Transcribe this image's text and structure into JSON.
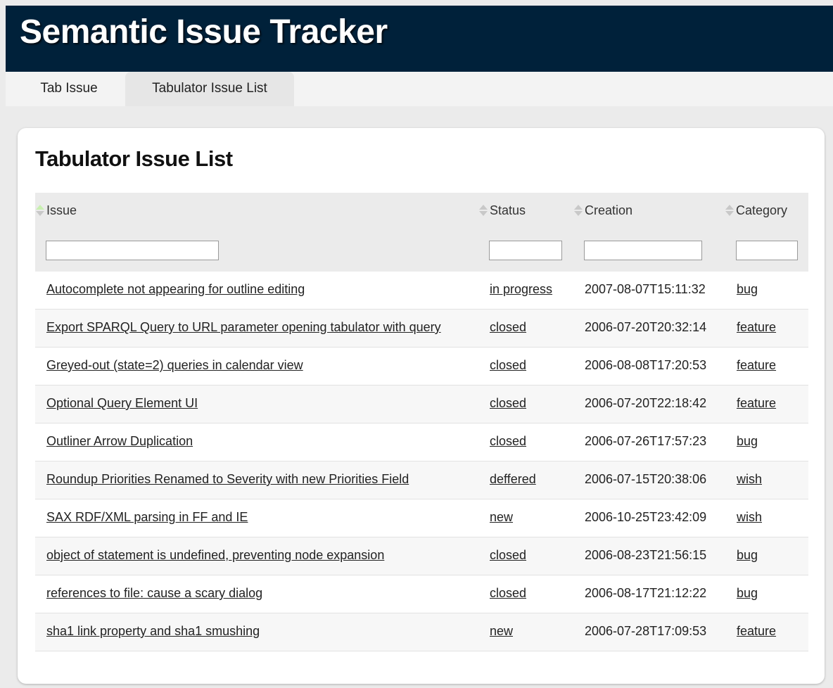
{
  "app": {
    "title": "Semantic Issue Tracker"
  },
  "tabs": [
    {
      "label": "Tab Issue"
    },
    {
      "label": "Tabulator Issue List"
    }
  ],
  "page": {
    "title": "Tabulator Issue List"
  },
  "table": {
    "columns": [
      "Issue",
      "Status",
      "Creation",
      "Category"
    ],
    "filters": [
      "",
      "",
      "",
      ""
    ],
    "rows": [
      {
        "issue": "Autocomplete not appearing for outline editing",
        "status": "in progress",
        "creation": "2007-08-07T15:11:32",
        "category": "bug"
      },
      {
        "issue": "Export SPARQL Query to URL parameter opening tabulator with query",
        "status": "closed",
        "creation": "2006-07-20T20:32:14",
        "category": "feature"
      },
      {
        "issue": "Greyed-out (state=2) queries in calendar view",
        "status": "closed",
        "creation": "2006-08-08T17:20:53",
        "category": "feature"
      },
      {
        "issue": "Optional Query Element UI",
        "status": "closed",
        "creation": "2006-07-20T22:18:42",
        "category": "feature"
      },
      {
        "issue": "Outliner Arrow Duplication",
        "status": "closed",
        "creation": "2006-07-26T17:57:23",
        "category": "bug"
      },
      {
        "issue": "Roundup Priorities Renamed to Severity with new Priorities Field",
        "status": "deffered",
        "creation": "2006-07-15T20:38:06",
        "category": "wish"
      },
      {
        "issue": "SAX RDF/XML parsing in FF and IE",
        "status": "new",
        "creation": "2006-10-25T23:42:09",
        "category": "wish"
      },
      {
        "issue": "object of statement is undefined, preventing node expansion",
        "status": "closed",
        "creation": "2006-08-23T21:56:15",
        "category": "bug"
      },
      {
        "issue": "references to file: cause a scary dialog",
        "status": "closed",
        "creation": "2006-08-17T21:12:22",
        "category": "bug"
      },
      {
        "issue": "sha1 link property and sha1 smushing",
        "status": "new",
        "creation": "2006-07-28T17:09:53",
        "category": "feature"
      }
    ]
  }
}
